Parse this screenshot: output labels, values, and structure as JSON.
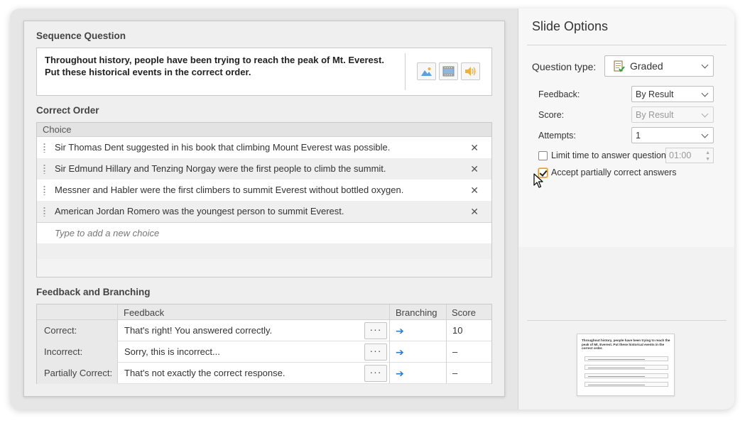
{
  "editor": {
    "question_section_title": "Sequence Question",
    "question_line1": "Throughout history, people have been trying to reach the peak of Mt. Everest.",
    "question_line2": "Put these historical events in the correct order.",
    "media_buttons": [
      "image-icon",
      "video-icon",
      "audio-icon"
    ],
    "correct_order_title": "Correct Order",
    "choice_header": "Choice",
    "choices": [
      "Sir Thomas Dent suggested in his book that climbing Mount Everest was possible.",
      "Sir Edmund Hillary and Tenzing Norgay were the first people to climb the summit.",
      "Messner and Habler were the first climbers to summit Everest without bottled oxygen.",
      "American Jordan Romero was the youngest person to summit Everest."
    ],
    "add_choice_placeholder": "Type to add a new choice",
    "feedback_section_title": "Feedback and Branching",
    "feedback_headers": {
      "feedback": "Feedback",
      "branching": "Branching",
      "score": "Score"
    },
    "feedback_rows": [
      {
        "label": "Correct:",
        "text": "That's right! You answered correctly.",
        "dots": "···",
        "arrow": "➔",
        "score": "10"
      },
      {
        "label": "Incorrect:",
        "text": "Sorry, this is incorrect...",
        "dots": "···",
        "arrow": "➔",
        "score": "–"
      },
      {
        "label": "Partially Correct:",
        "text": "That's not exactly the correct response.",
        "dots": "···",
        "arrow": "➔",
        "score": "–"
      }
    ]
  },
  "options": {
    "title": "Slide Options",
    "question_type_label": "Question type:",
    "question_type_value": "Graded",
    "feedback_label": "Feedback:",
    "feedback_value": "By Result",
    "score_label": "Score:",
    "score_value": "By Result",
    "attempts_label": "Attempts:",
    "attempts_value": "1",
    "limit_time_label": "Limit time to answer question:",
    "limit_time_value": "01:00",
    "limit_time_checked": false,
    "accept_partial_label": "Accept partially correct answers",
    "accept_partial_checked": true,
    "delete_glyph": "✕",
    "thumbnail_title": "Throughout history, people have been trying to reach the peak of Mt. Everest. Put these historical events in the correct order."
  },
  "colors": {
    "accent_blue": "#2a7bd4",
    "focus_orange": "#e59b25"
  }
}
